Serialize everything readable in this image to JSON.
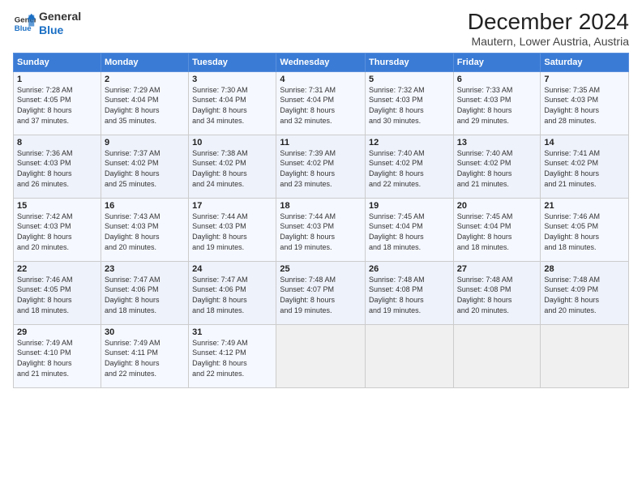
{
  "logo": {
    "line1": "General",
    "line2": "Blue"
  },
  "title": "December 2024",
  "subtitle": "Mautern, Lower Austria, Austria",
  "days_header": [
    "Sunday",
    "Monday",
    "Tuesday",
    "Wednesday",
    "Thursday",
    "Friday",
    "Saturday"
  ],
  "weeks": [
    [
      {
        "day": "1",
        "info": "Sunrise: 7:28 AM\nSunset: 4:05 PM\nDaylight: 8 hours\nand 37 minutes."
      },
      {
        "day": "2",
        "info": "Sunrise: 7:29 AM\nSunset: 4:04 PM\nDaylight: 8 hours\nand 35 minutes."
      },
      {
        "day": "3",
        "info": "Sunrise: 7:30 AM\nSunset: 4:04 PM\nDaylight: 8 hours\nand 34 minutes."
      },
      {
        "day": "4",
        "info": "Sunrise: 7:31 AM\nSunset: 4:04 PM\nDaylight: 8 hours\nand 32 minutes."
      },
      {
        "day": "5",
        "info": "Sunrise: 7:32 AM\nSunset: 4:03 PM\nDaylight: 8 hours\nand 30 minutes."
      },
      {
        "day": "6",
        "info": "Sunrise: 7:33 AM\nSunset: 4:03 PM\nDaylight: 8 hours\nand 29 minutes."
      },
      {
        "day": "7",
        "info": "Sunrise: 7:35 AM\nSunset: 4:03 PM\nDaylight: 8 hours\nand 28 minutes."
      }
    ],
    [
      {
        "day": "8",
        "info": "Sunrise: 7:36 AM\nSunset: 4:03 PM\nDaylight: 8 hours\nand 26 minutes."
      },
      {
        "day": "9",
        "info": "Sunrise: 7:37 AM\nSunset: 4:02 PM\nDaylight: 8 hours\nand 25 minutes."
      },
      {
        "day": "10",
        "info": "Sunrise: 7:38 AM\nSunset: 4:02 PM\nDaylight: 8 hours\nand 24 minutes."
      },
      {
        "day": "11",
        "info": "Sunrise: 7:39 AM\nSunset: 4:02 PM\nDaylight: 8 hours\nand 23 minutes."
      },
      {
        "day": "12",
        "info": "Sunrise: 7:40 AM\nSunset: 4:02 PM\nDaylight: 8 hours\nand 22 minutes."
      },
      {
        "day": "13",
        "info": "Sunrise: 7:40 AM\nSunset: 4:02 PM\nDaylight: 8 hours\nand 21 minutes."
      },
      {
        "day": "14",
        "info": "Sunrise: 7:41 AM\nSunset: 4:02 PM\nDaylight: 8 hours\nand 21 minutes."
      }
    ],
    [
      {
        "day": "15",
        "info": "Sunrise: 7:42 AM\nSunset: 4:03 PM\nDaylight: 8 hours\nand 20 minutes."
      },
      {
        "day": "16",
        "info": "Sunrise: 7:43 AM\nSunset: 4:03 PM\nDaylight: 8 hours\nand 20 minutes."
      },
      {
        "day": "17",
        "info": "Sunrise: 7:44 AM\nSunset: 4:03 PM\nDaylight: 8 hours\nand 19 minutes."
      },
      {
        "day": "18",
        "info": "Sunrise: 7:44 AM\nSunset: 4:03 PM\nDaylight: 8 hours\nand 19 minutes."
      },
      {
        "day": "19",
        "info": "Sunrise: 7:45 AM\nSunset: 4:04 PM\nDaylight: 8 hours\nand 18 minutes."
      },
      {
        "day": "20",
        "info": "Sunrise: 7:45 AM\nSunset: 4:04 PM\nDaylight: 8 hours\nand 18 minutes."
      },
      {
        "day": "21",
        "info": "Sunrise: 7:46 AM\nSunset: 4:05 PM\nDaylight: 8 hours\nand 18 minutes."
      }
    ],
    [
      {
        "day": "22",
        "info": "Sunrise: 7:46 AM\nSunset: 4:05 PM\nDaylight: 8 hours\nand 18 minutes."
      },
      {
        "day": "23",
        "info": "Sunrise: 7:47 AM\nSunset: 4:06 PM\nDaylight: 8 hours\nand 18 minutes."
      },
      {
        "day": "24",
        "info": "Sunrise: 7:47 AM\nSunset: 4:06 PM\nDaylight: 8 hours\nand 18 minutes."
      },
      {
        "day": "25",
        "info": "Sunrise: 7:48 AM\nSunset: 4:07 PM\nDaylight: 8 hours\nand 19 minutes."
      },
      {
        "day": "26",
        "info": "Sunrise: 7:48 AM\nSunset: 4:08 PM\nDaylight: 8 hours\nand 19 minutes."
      },
      {
        "day": "27",
        "info": "Sunrise: 7:48 AM\nSunset: 4:08 PM\nDaylight: 8 hours\nand 20 minutes."
      },
      {
        "day": "28",
        "info": "Sunrise: 7:48 AM\nSunset: 4:09 PM\nDaylight: 8 hours\nand 20 minutes."
      }
    ],
    [
      {
        "day": "29",
        "info": "Sunrise: 7:49 AM\nSunset: 4:10 PM\nDaylight: 8 hours\nand 21 minutes."
      },
      {
        "day": "30",
        "info": "Sunrise: 7:49 AM\nSunset: 4:11 PM\nDaylight: 8 hours\nand 22 minutes."
      },
      {
        "day": "31",
        "info": "Sunrise: 7:49 AM\nSunset: 4:12 PM\nDaylight: 8 hours\nand 22 minutes."
      },
      null,
      null,
      null,
      null
    ]
  ]
}
